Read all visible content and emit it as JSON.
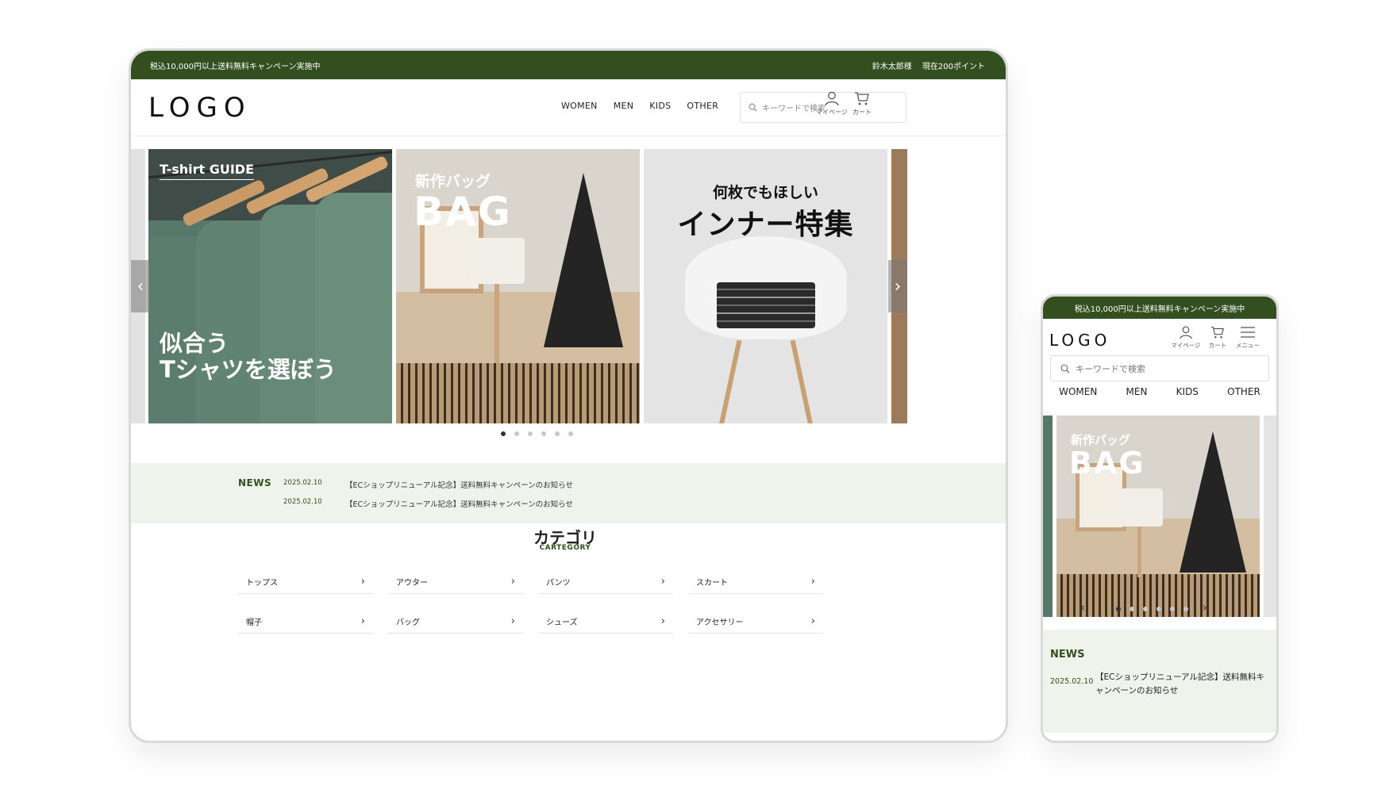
{
  "campaign_banner": "税込10,000円以上送料無料キャンペーン実施中",
  "user": {
    "name": "鈴木太郎様",
    "points": "現在200ポイント"
  },
  "logo": "LOGO",
  "nav": [
    "WOMEN",
    "MEN",
    "KIDS",
    "OTHER"
  ],
  "search_placeholder": "キーワードで検索",
  "icons": {
    "mypage": "マイページ",
    "cart": "カート",
    "menu": "メニュー"
  },
  "slides": {
    "tshirt": {
      "tag": "T-shirt GUIDE",
      "line1": "似合う",
      "line2": "Tシャツを選ぼう"
    },
    "bag": {
      "sub": "新作バッグ",
      "title": "BAG"
    },
    "inner": {
      "sub": "何枚でもほしい",
      "title": "インナー特集"
    }
  },
  "slider_dot_count": 6,
  "news": {
    "label": "NEWS",
    "items": [
      {
        "date": "2025.02.10",
        "text": "【ECショップリニューアル記念】送料無料キャンペーンのお知らせ"
      },
      {
        "date": "2025.02.10",
        "text": "【ECショップリニューアル記念】送料無料キャンペーンのお知らせ"
      }
    ]
  },
  "category": {
    "title": "カテゴリ",
    "subtitle": "CARTEGORY",
    "items": [
      "トップス",
      "アウター",
      "パンツ",
      "スカート",
      "帽子",
      "バッグ",
      "シューズ",
      "アクセサリー"
    ]
  },
  "colors": {
    "brand_green": "#344f1f",
    "news_bg": "#f0f3ec"
  }
}
